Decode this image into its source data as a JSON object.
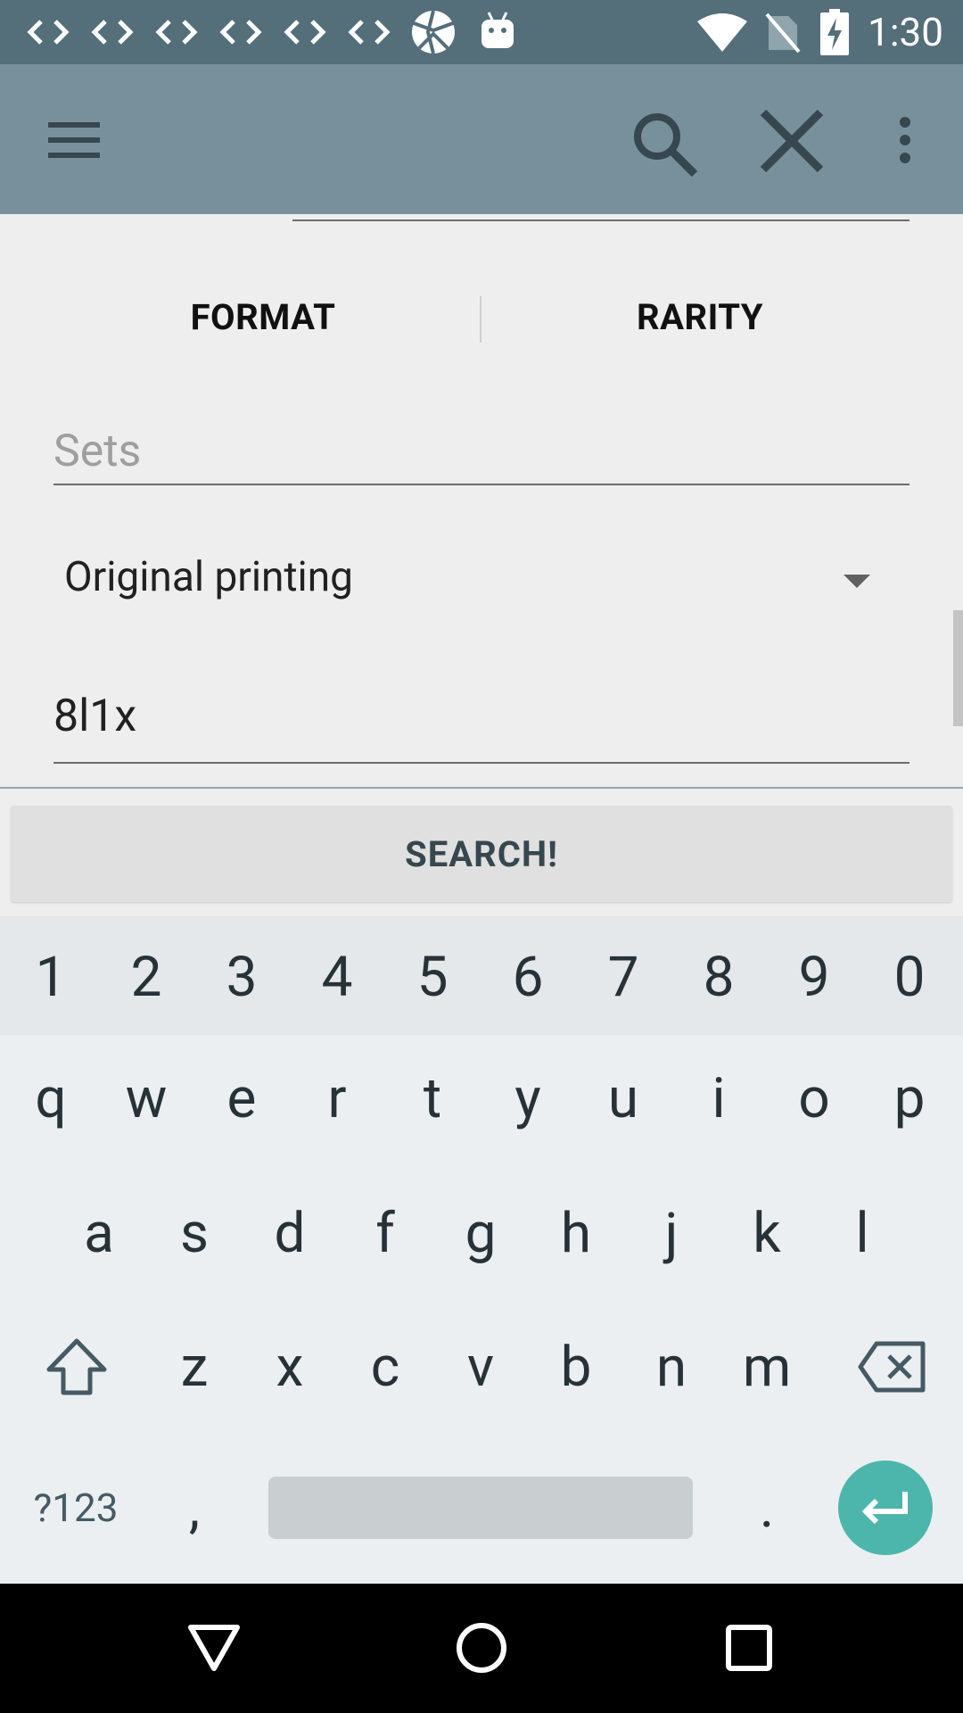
{
  "status_bar": {
    "time": "1:30",
    "left_icons": [
      "code-icon",
      "code-icon",
      "code-icon",
      "code-icon",
      "code-icon",
      "code-icon",
      "aperture-icon",
      "android-icon"
    ],
    "right_icons": [
      "wifi-icon",
      "no-sim-icon",
      "battery-charging-icon"
    ]
  },
  "toolbar": {
    "menu_icon": "hamburger-menu-icon",
    "search_icon": "search-icon",
    "close_icon": "close-icon",
    "overflow_icon": "more-vert-icon"
  },
  "tabs": {
    "format_label": "FORMAT",
    "rarity_label": "RARITY"
  },
  "sets_field": {
    "placeholder": "Sets",
    "value": ""
  },
  "printing_spinner": {
    "selected": "Original printing"
  },
  "query_field": {
    "value": "8l1x"
  },
  "search_button": {
    "label": "SEARCH!"
  },
  "keyboard": {
    "number_row": [
      "1",
      "2",
      "3",
      "4",
      "5",
      "6",
      "7",
      "8",
      "9",
      "0"
    ],
    "row1": [
      "q",
      "w",
      "e",
      "r",
      "t",
      "y",
      "u",
      "i",
      "o",
      "p"
    ],
    "row2": [
      "a",
      "s",
      "d",
      "f",
      "g",
      "h",
      "j",
      "k",
      "l"
    ],
    "row3": [
      "z",
      "x",
      "c",
      "v",
      "b",
      "n",
      "m"
    ],
    "symbols_label": "?123",
    "comma": ",",
    "period": ".",
    "accent_color": "#4db6ac"
  },
  "colors": {
    "status_bar": "#546e7a",
    "toolbar": "#78909c",
    "background": "#eeeeee"
  }
}
